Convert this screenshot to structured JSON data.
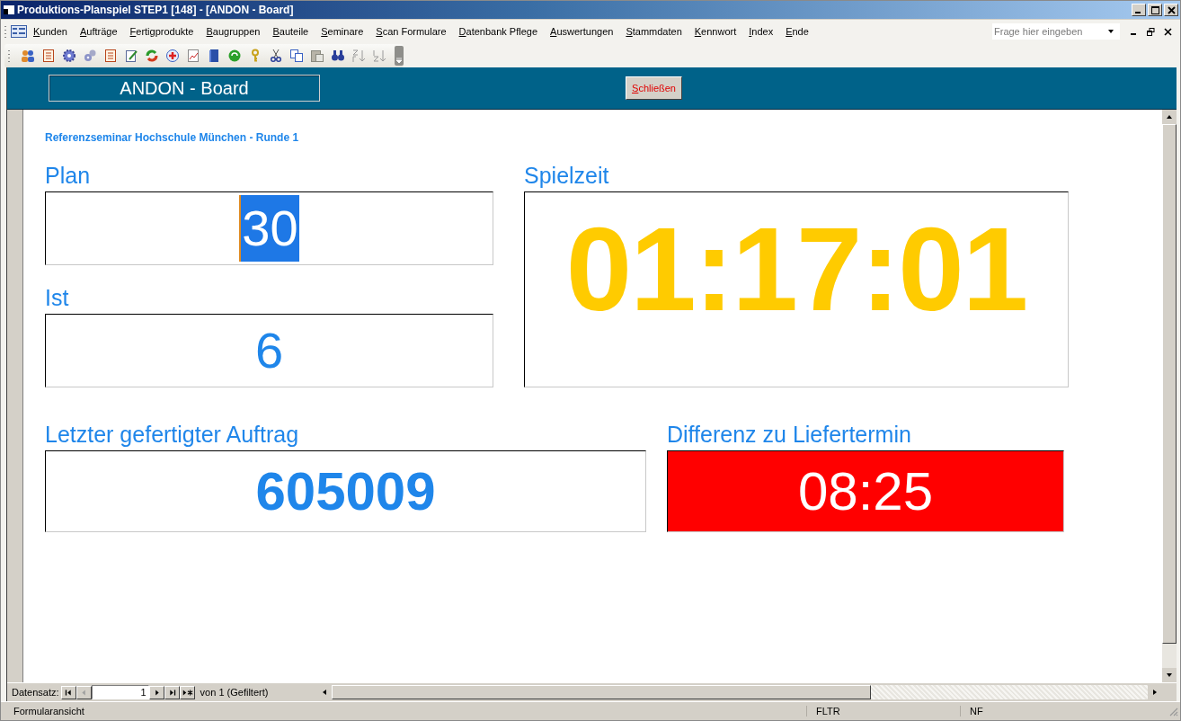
{
  "window": {
    "title": "Produktions-Planspiel STEP1 [148] - [ANDON - Board]"
  },
  "menu": [
    "Kunden",
    "Aufträge",
    "Fertigprodukte",
    "Baugruppen",
    "Bauteile",
    "Seminare",
    "Scan Formulare",
    "Datenbank Pflege",
    "Auswertungen",
    "Stammdaten",
    "Kennwort",
    "Index",
    "Ende"
  ],
  "help_search": {
    "placeholder": "Frage hier eingeben"
  },
  "form_header": {
    "title": "ANDON - Board",
    "close_button": "Schließen"
  },
  "subtitle": "Referenzseminar Hochschule München - Runde 1",
  "plan": {
    "label": "Plan",
    "value": "30",
    "highlighted": true
  },
  "ist": {
    "label": "Ist",
    "value": "6",
    "highlighted": false
  },
  "spielzeit": {
    "label": "Spielzeit",
    "value": "01:17:01"
  },
  "letzter_auftrag": {
    "label": "Letzter gefertigter Auftrag",
    "value": "605009"
  },
  "differenz": {
    "label": "Differenz zu Liefertermin",
    "value": "08:25",
    "alert": true
  },
  "navigation": {
    "label": "Datensatz:",
    "record": "1",
    "count": "von  1 (Gefiltert)"
  },
  "status_bar": {
    "view": "Formularansicht",
    "indicators": [
      "FLTR",
      "NF"
    ]
  }
}
